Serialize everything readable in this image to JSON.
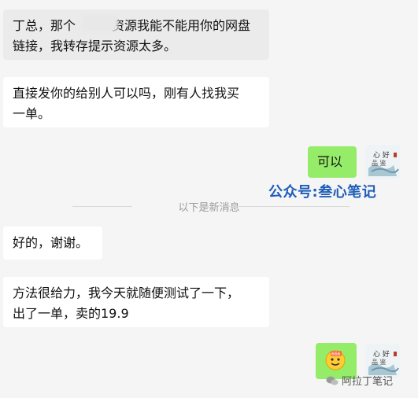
{
  "messages": [
    {
      "side": "in",
      "text_line1": "丁总，那个",
      "text_line1b": "资源我能不能用你的网盘",
      "text_line2": "链接，我转存提示资源太多。"
    },
    {
      "side": "in",
      "text_line1": "直接发你的给别人可以吗，刚有人找我买",
      "text_line2": "一单。"
    },
    {
      "side": "out",
      "text": "可以"
    },
    {
      "side": "in",
      "text": "好的，谢谢。"
    },
    {
      "side": "in",
      "text_line1": "方法很给力，我今天就随便测试了一下，",
      "text_line2": "出了一单，卖的19.9"
    },
    {
      "side": "out",
      "emoji": "666-sticker"
    }
  ],
  "divider_text": "以下是新消息",
  "watermark_text": "公众号:叁心笔记",
  "footer_mark_text": "阿拉丁笔记",
  "colors": {
    "background": "#f5f5f5",
    "outgoing": "#95ec69",
    "incoming": "#ffffff",
    "watermark": "#1e5db8"
  }
}
